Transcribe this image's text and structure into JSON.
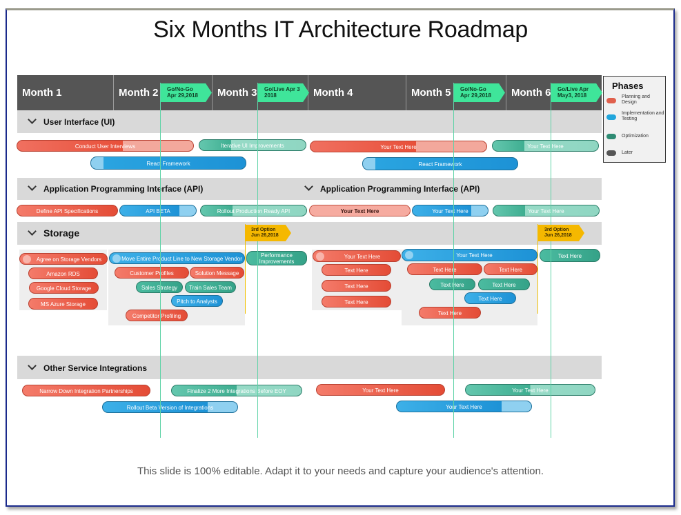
{
  "title": "Six Months IT Architecture Roadmap",
  "footer": "This slide is 100% editable. Adapt it to your needs and capture your audience's attention.",
  "colors": {
    "planning_design": "#e8503a",
    "implementation_testing": "#1d92d6",
    "optimization": "#35a288",
    "later": "#555555",
    "milestone_green": "#3fe59a",
    "milestone_yellow": "#f5b800",
    "header": "#555555",
    "section_band": "#d9d9d9"
  },
  "months": [
    "Month 1",
    "Month 2",
    "Month 3",
    "Month 4",
    "Month 5",
    "Month 6"
  ],
  "milestones": [
    {
      "line1": "Go/No-Go",
      "line2": "Apr 29,2018"
    },
    {
      "line1": "Go/Live Apr 3",
      "line2": "2018"
    },
    {
      "line1": "Go/No-Go",
      "line2": "Apr 29,2018"
    },
    {
      "line1": "Go/Live Apr",
      "line2": "May3, 2018"
    }
  ],
  "option_markers": [
    {
      "line1": "3rd Option",
      "line2": "Jun 26,2018"
    },
    {
      "line1": "3rd Option",
      "line2": "Jun 26,2018"
    }
  ],
  "legend": {
    "title": "Phases",
    "items": [
      {
        "label": "Planning and Design",
        "phase": "planning"
      },
      {
        "label": "Implementation and Testing",
        "phase": "implementation"
      },
      {
        "label": "Optimization",
        "phase": "optimization"
      },
      {
        "label": "Later",
        "phase": "later"
      }
    ]
  },
  "sections": {
    "ui": {
      "label": "User Interface (UI)",
      "tasks": [
        "Conduct User Interviews",
        "Iterative UI Improvements",
        "Your Text Here",
        "Your Text Here",
        "React Framework",
        "React Framework"
      ]
    },
    "api": {
      "label": "Application  Programming Interface (API)",
      "label_right": "Application  Programming Interface (API)",
      "tasks": [
        "Define API Specifications",
        "API BETA",
        "Rollout Production Ready API",
        "Your Text Here",
        "Your Text Here",
        "Your Text Here"
      ]
    },
    "storage": {
      "label": "Storage",
      "tasks_left": [
        "Agree on Storage Vendors",
        "Amazon RDS",
        "Google Cloud Storage",
        "MS Azure  Storage"
      ],
      "tasks_mid": [
        "Move Entire Product Line to New  Storage Vendor",
        "Customer Profiles",
        "Solution Message",
        "Sales  Strategy",
        "Train  Sales  Team",
        "Pitch to Analysts",
        "Competitor Profiling"
      ],
      "performance": "Performance Improvements",
      "tasks_m4": [
        "Your Text Here",
        "Text Here",
        "Text Here",
        "Text Here"
      ],
      "tasks_m5": [
        "Your Text Here",
        "Text Here",
        "Text Here",
        "Text Here",
        "Text Here",
        "Text Here",
        "Text Here"
      ],
      "tasks_m6": [
        "Text Here"
      ]
    },
    "other": {
      "label": "Other Service Integrations",
      "tasks": [
        "Narrow Down Integration Partnerships",
        "Finalize 2 More Integrations Before EOY",
        "Rollout Beta Version  of Integrations",
        "Your Text Here",
        "Your Text Here",
        "Your Text Here"
      ]
    }
  }
}
